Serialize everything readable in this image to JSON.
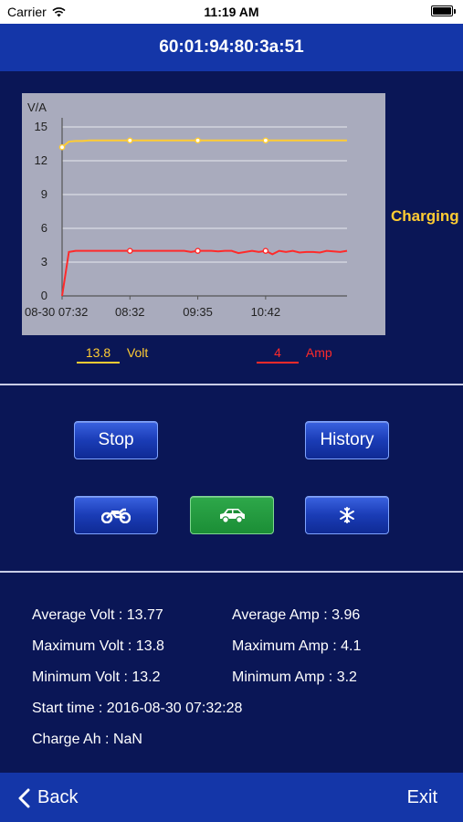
{
  "status_bar": {
    "carrier": "Carrier",
    "time": "11:19 AM"
  },
  "header": {
    "title": "60:01:94:80:3a:51"
  },
  "status_label": "Charging",
  "readouts": {
    "volt_value": "13.8",
    "volt_unit": "Volt",
    "amp_value": "4",
    "amp_unit": "Amp"
  },
  "buttons": {
    "stop": "Stop",
    "history": "History"
  },
  "modes": [
    {
      "name": "motorcycle",
      "icon": "motorcycle-icon",
      "selected": false
    },
    {
      "name": "car",
      "icon": "car-icon",
      "selected": true
    },
    {
      "name": "snowflake",
      "icon": "snowflake-icon",
      "selected": false
    }
  ],
  "stats": {
    "avg_volt": "Average Volt : 13.77",
    "avg_amp": "Average Amp : 3.96",
    "max_volt": "Maximum Volt : 13.8",
    "max_amp": "Maximum Amp : 4.1",
    "min_volt": "Minimum Volt : 13.2",
    "min_amp": "Minimum Amp : 3.2",
    "start_time": "Start time : 2016-08-30 07:32:28",
    "charge_ah": "Charge Ah : NaN"
  },
  "bottom": {
    "back": "Back",
    "exit": "Exit"
  },
  "colors": {
    "volt": "#ffcc33",
    "amp": "#ff2a2a",
    "selected_mode": "#1b8e36"
  },
  "chart_data": {
    "type": "line",
    "ylabel": "V/A",
    "ylim": [
      0,
      15
    ],
    "yticks": [
      0,
      3,
      6,
      9,
      12,
      15
    ],
    "x_tick_labels": [
      "08-30 07:32",
      "08:32",
      "09:35",
      "10:42"
    ],
    "grid": true,
    "series": [
      {
        "color": "#ffcc33",
        "values": [
          13.2,
          13.7,
          13.75,
          13.75,
          13.8,
          13.8,
          13.8,
          13.8,
          13.8,
          13.8,
          13.8,
          13.8,
          13.8,
          13.8,
          13.8,
          13.8,
          13.8,
          13.8,
          13.8,
          13.8,
          13.8,
          13.8,
          13.8,
          13.8,
          13.8,
          13.8,
          13.8,
          13.8,
          13.8,
          13.8,
          13.8,
          13.8,
          13.8,
          13.8,
          13.8,
          13.8,
          13.8,
          13.8,
          13.8,
          13.8,
          13.8,
          13.8,
          13.8
        ],
        "marker_indices": [
          0,
          10,
          20,
          30
        ]
      },
      {
        "color": "#ff2a2a",
        "values": [
          0,
          3.9,
          4.0,
          4.0,
          4.0,
          4.0,
          4.0,
          4.0,
          4.0,
          4.0,
          4.0,
          4.0,
          4.0,
          4.0,
          4.0,
          4.0,
          4.0,
          4.0,
          4.0,
          3.9,
          4.0,
          4.0,
          4.0,
          3.95,
          4.0,
          4.0,
          3.8,
          3.9,
          4.0,
          3.9,
          4.0,
          3.7,
          4.0,
          3.9,
          4.0,
          3.85,
          3.9,
          3.9,
          3.85,
          4.0,
          3.95,
          3.9,
          4.0
        ],
        "marker_indices": [
          10,
          20,
          30
        ]
      }
    ]
  }
}
